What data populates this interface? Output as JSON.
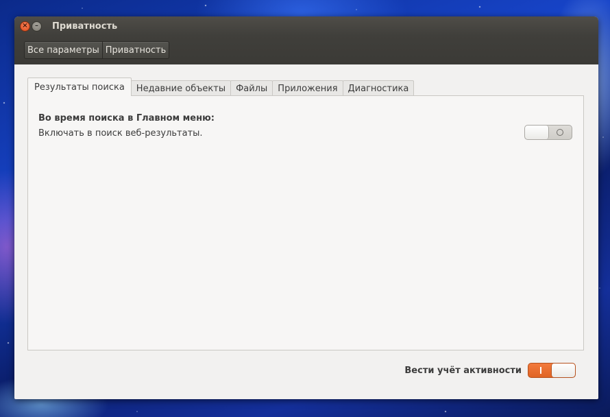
{
  "window": {
    "title": "Приватность",
    "close_glyph": "×",
    "minimize_glyph": "–"
  },
  "breadcrumb": {
    "items": [
      "Все параметры",
      "Приватность"
    ]
  },
  "tabs": [
    {
      "label": "Результаты поиска",
      "active": true
    },
    {
      "label": "Недавние объекты",
      "active": false
    },
    {
      "label": "Файлы",
      "active": false
    },
    {
      "label": "Приложения",
      "active": false
    },
    {
      "label": "Диагностика",
      "active": false
    }
  ],
  "search_results": {
    "heading": "Во время поиска в Главном меню:",
    "description": "Включать в поиск веб-результаты.",
    "web_results_enabled": false
  },
  "footer": {
    "activity_label": "Вести учёт активности",
    "activity_enabled": true
  },
  "colors": {
    "switch_on": "#e9692c",
    "titlebar": "#45443f",
    "window_bg": "#f2f1f0"
  },
  "icons": {
    "close": "close-icon",
    "minimize": "minimize-icon"
  }
}
